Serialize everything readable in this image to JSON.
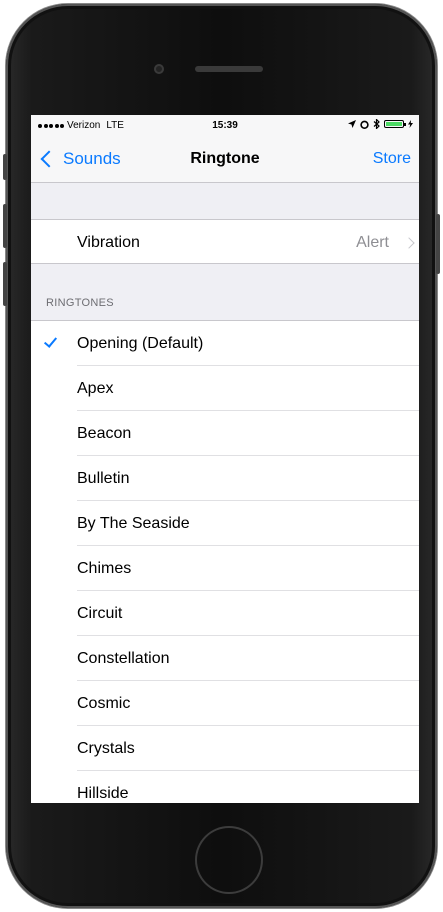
{
  "status_bar": {
    "carrier": "Verizon",
    "network": "LTE",
    "time": "15:39",
    "icons": [
      "location-icon",
      "alarm-icon",
      "bluetooth-icon",
      "battery-icon",
      "charging-icon"
    ]
  },
  "nav": {
    "back_label": "Sounds",
    "title": "Ringtone",
    "action_label": "Store"
  },
  "vibration": {
    "label": "Vibration",
    "value": "Alert"
  },
  "ringtones": {
    "header": "RINGTONES",
    "selected_index": 0,
    "items": [
      "Opening (Default)",
      "Apex",
      "Beacon",
      "Bulletin",
      "By The Seaside",
      "Chimes",
      "Circuit",
      "Constellation",
      "Cosmic",
      "Crystals",
      "Hillside"
    ]
  },
  "colors": {
    "accent": "#0a7aff",
    "background": "#efeff4",
    "secondary_text": "#8e8e93"
  }
}
